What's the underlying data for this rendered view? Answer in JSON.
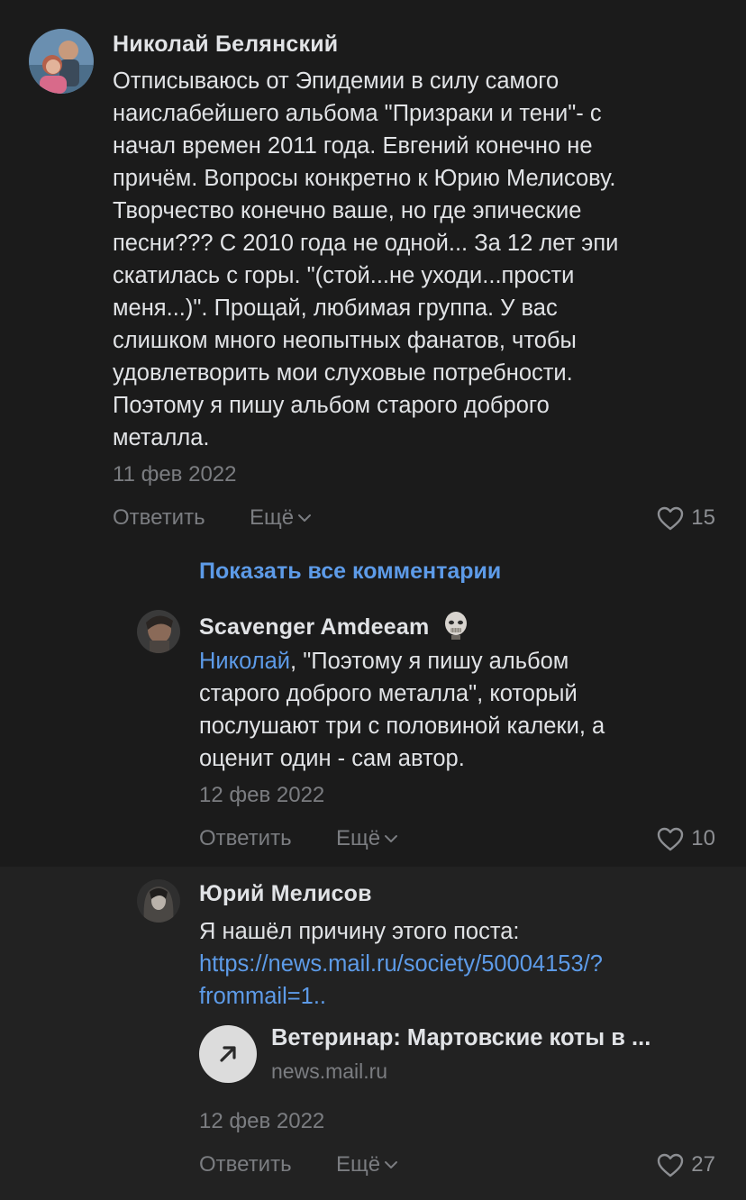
{
  "comments": [
    {
      "author": "Николай Белянский",
      "text_lines": [
        "Отписываюсь от Эпидемии в силу самого",
        "наислабейшего альбома \"Призраки и тени\"- с",
        "начал времен 2011 года. Евгений конечно не",
        "причём. Вопросы конкретно к Юрию Мелисову.",
        "Творчество конечно ваше, но где эпические",
        "песни??? С 2010 года не одной... За 12 лет эпи",
        "скатилась с горы. \"(стой...не уходи...прости",
        "меня...)\". Прощай, любимая группа. У вас",
        "слишком много неопытных фанатов, чтобы",
        "удовлетворить мои слуховые потребности.",
        "Поэтому я пишу альбом старого доброго",
        "металла."
      ],
      "date": "11 фев 2022",
      "reply_label": "Ответить",
      "more_label": "Ещё",
      "likes": "15"
    },
    {
      "author": "Scavenger Amdeeam",
      "mention": "Николай",
      "text_lines": [
        ", \"Поэтому я пишу альбом",
        "старого доброго металла\", который",
        "послушают три с половиной калеки, а",
        "оценит один - сам автор."
      ],
      "date": "12 фев 2022",
      "reply_label": "Ответить",
      "more_label": "Ещё",
      "likes": "10"
    },
    {
      "author": "Юрий Мелисов",
      "text_lines": [
        "Я нашёл причину этого поста:"
      ],
      "link_lines": [
        "https://news.mail.ru/society/50004153/?",
        "frommail=1.."
      ],
      "snippet": {
        "title": "Ветеринар: Мартовские коты в ...",
        "domain": "news.mail.ru",
        "icon": "arrow-up-right-icon"
      },
      "date": "12 фев 2022",
      "reply_label": "Ответить",
      "more_label": "Ещё",
      "likes": "27"
    }
  ],
  "show_all_label": "Показать все комментарии",
  "colors": {
    "background": "#1b1b1b",
    "highlight_background": "#222222",
    "text": "#e1e3e6",
    "secondary": "#7b7d81",
    "accent": "#5d9be8"
  }
}
